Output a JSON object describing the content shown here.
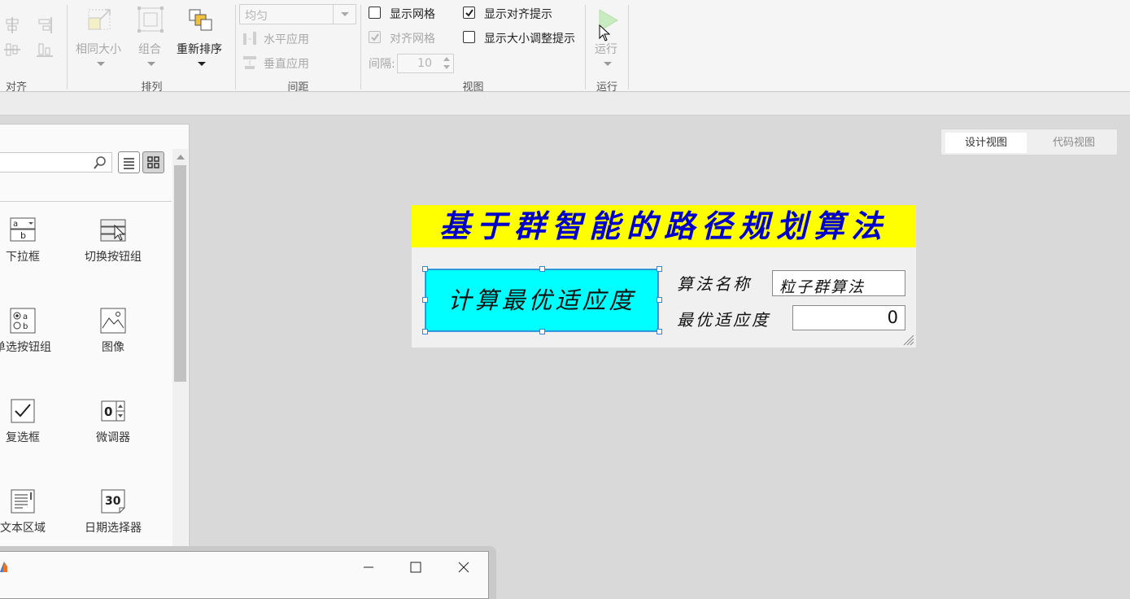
{
  "ribbon": {
    "sections": {
      "align": "对齐",
      "arrange": "排列",
      "spacing": "间距",
      "view": "视图",
      "run": "运行"
    },
    "arrange": {
      "same_size": "相同大小",
      "group": "组合",
      "reorder": "重新排序"
    },
    "spacing": {
      "distribution": "均匀",
      "apply_horizontal": "水平应用",
      "apply_vertical": "垂直应用",
      "interval_label": "间隔:",
      "interval_value": "10"
    },
    "view": {
      "show_grid": {
        "label": "显示网格",
        "checked": false
      },
      "snap_grid": {
        "label": "对齐网格",
        "checked": true,
        "disabled": true
      },
      "show_align_hints": {
        "label": "显示对齐提示",
        "checked": true
      },
      "show_resize_hints": {
        "label": "显示大小调整提示",
        "checked": false
      }
    },
    "run": {
      "label": "运行"
    }
  },
  "library": {
    "search_placeholder": "",
    "components": [
      {
        "label": "下拉框",
        "icon": "dropdown-icon"
      },
      {
        "label": "切换按钮组",
        "icon": "toggle-button-group-icon"
      },
      {
        "label": "单选按钮组",
        "icon": "radio-button-group-icon"
      },
      {
        "label": "图像",
        "icon": "image-icon"
      },
      {
        "label": "复选框",
        "icon": "checkbox-icon"
      },
      {
        "label": "微调器",
        "icon": "spinner-icon"
      },
      {
        "label": "文本区域",
        "icon": "text-area-icon"
      },
      {
        "label": "日期选择器",
        "icon": "date-picker-icon"
      }
    ],
    "icon_text": {
      "dropdown_a": "a",
      "dropdown_b": "b",
      "radio_a": "a",
      "radio_b": "b",
      "spinner_zero": "0",
      "date_num": "30"
    }
  },
  "view_toggle": {
    "design": "设计视图",
    "code": "代码视图"
  },
  "app": {
    "title": "基于群智能的路径规划算法",
    "calc_button": "计算最优适应度",
    "algo_name_label": "算法名称",
    "algo_name_value": "粒子群算法",
    "best_fitness_label": "最优适应度",
    "best_fitness_value": "0"
  },
  "colors": {
    "title_bg": "#ffff00",
    "title_text": "#0000cc",
    "button_bg": "#00ffff",
    "selection": "#2b8ccf"
  }
}
